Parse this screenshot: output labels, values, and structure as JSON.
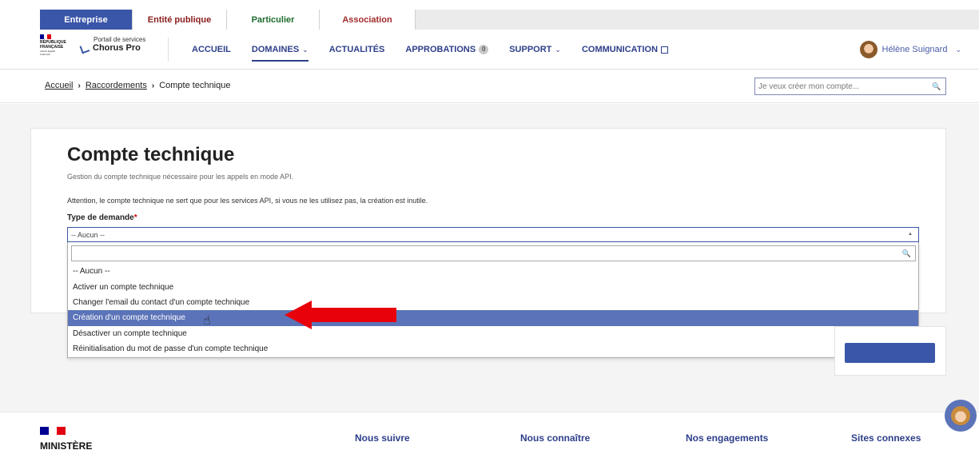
{
  "audience_tabs": [
    "Entreprise",
    "Entité publique",
    "Particulier",
    "Association"
  ],
  "header": {
    "logo_line1": "RÉPUBLIQUE",
    "logo_line2": "FRANÇAISE",
    "logo_motto": "Liberté Égalité Fraternité",
    "service_subtitle": "Portail de services",
    "service_name": "Chorus Pro"
  },
  "nav": {
    "accueil": "ACCUEIL",
    "domaines": "DOMAINES",
    "actualites": "ACTUALITÉS",
    "approbations": "APPROBATIONS",
    "approbations_count": "0",
    "support": "SUPPORT",
    "communication": "COMMUNICATION"
  },
  "user": {
    "name": "Hélène Suignard"
  },
  "breadcrumb": {
    "home": "Accueil",
    "parent": "Raccordements",
    "current": "Compte technique"
  },
  "search": {
    "placeholder": "Je veux créer mon compte..."
  },
  "page": {
    "title": "Compte technique",
    "subtitle": "Gestion du compte technique nécessaire pour les appels en mode API.",
    "warning": "Attention, le compte technique ne sert que pour les services API, si vous ne les utilisez pas, la création est inutile.",
    "field_label": "Type de demande",
    "required_mark": "*",
    "selected_value": "-- Aucun --"
  },
  "dropdown_options": [
    "-- Aucun --",
    "Activer un compte technique",
    "Changer l'email du contact d'un compte technique",
    "Création d'un compte technique",
    "Désactiver un compte technique",
    "Réinitialisation du mot de passe d'un compte technique"
  ],
  "highlighted_option_index": 3,
  "footer": {
    "ministry": "MINISTÈRE",
    "links": [
      "Nous suivre",
      "Nous connaître",
      "Nos engagements",
      "Sites connexes"
    ]
  },
  "colors": {
    "primary": "#3a56a8",
    "highlight": "#5b73b8",
    "arrow": "#e8000b"
  }
}
